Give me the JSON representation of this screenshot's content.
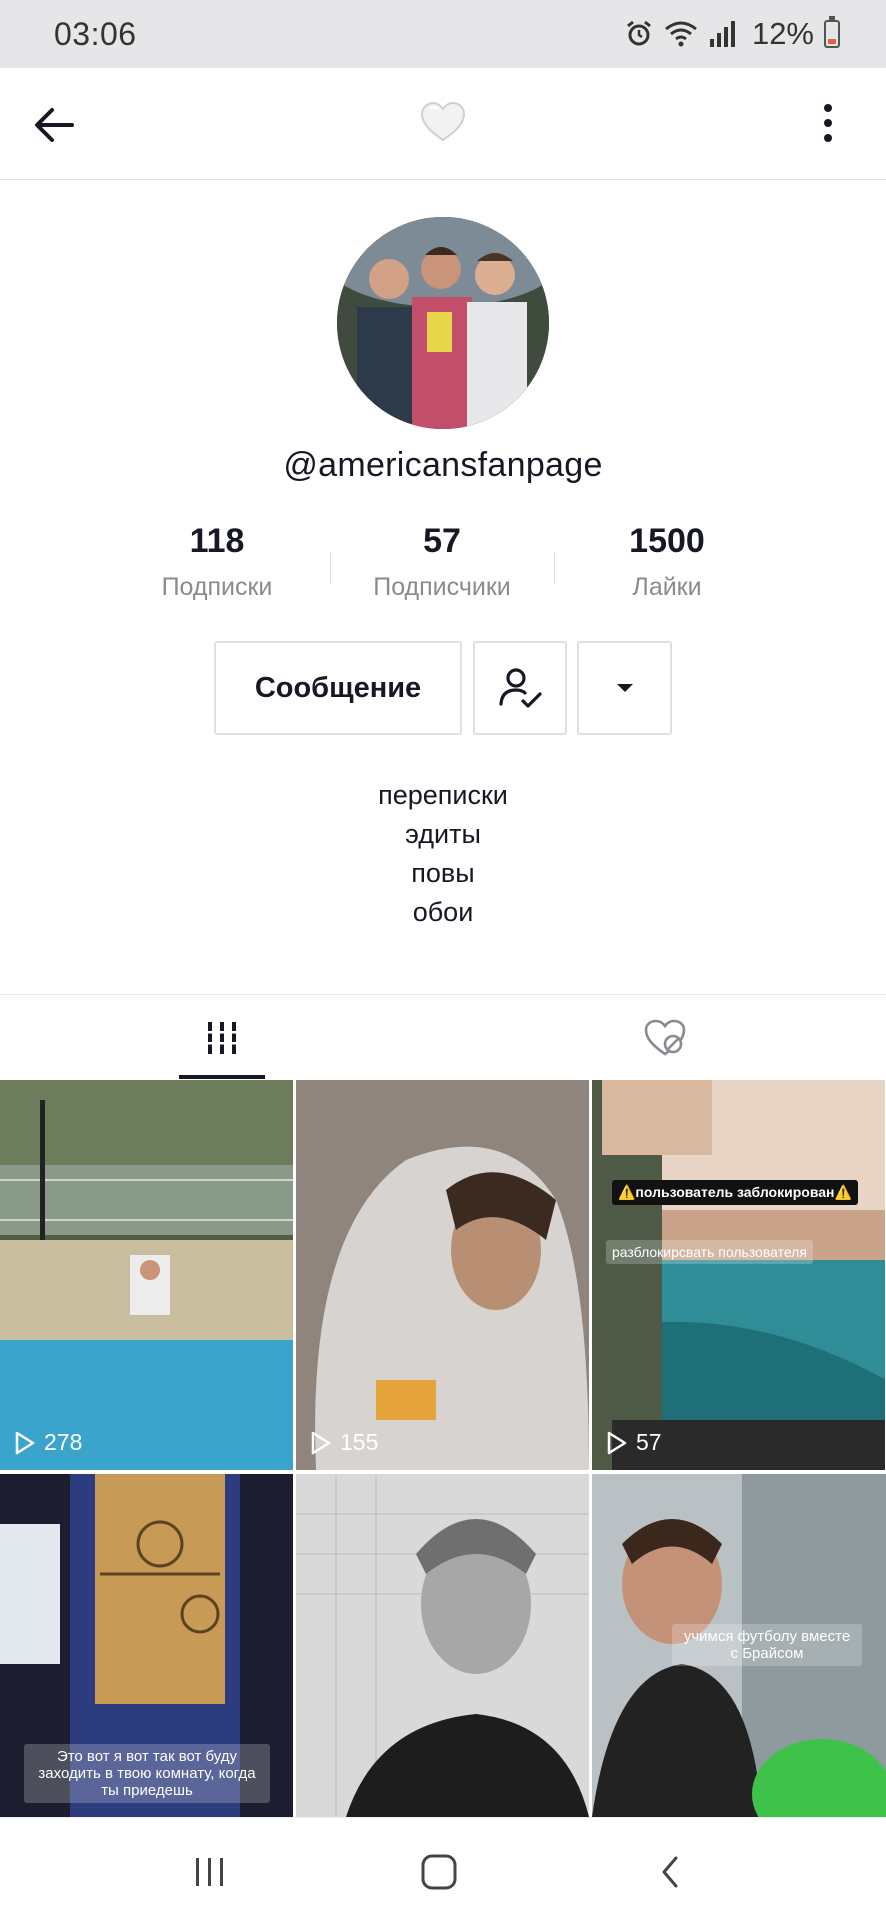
{
  "status_bar": {
    "time": "03:06",
    "battery": "12%"
  },
  "profile": {
    "username": "@americansfanpage",
    "stats": [
      {
        "value": "118",
        "label": "Подписки"
      },
      {
        "value": "57",
        "label": "Подписчики"
      },
      {
        "value": "1500",
        "label": "Лайки"
      }
    ],
    "message_button": "Сообщение",
    "bio": [
      "переписки",
      "эдиты",
      "повы",
      "обои"
    ]
  },
  "videos": [
    {
      "views": "278",
      "overlay": "",
      "colors": [
        "#5a6b48",
        "#bfb49a",
        "#3aa0c8"
      ]
    },
    {
      "views": "155",
      "overlay": "",
      "colors": [
        "#d9d6d4",
        "#a8a4a2",
        "#6a5f58"
      ]
    },
    {
      "views": "57",
      "overlay": "⚠️пользователь заблокирован⚠️",
      "overlay2": "разблокирсвать пользователя",
      "colors": [
        "#e9d2c2",
        "#5f6a5c",
        "#2c7f8c"
      ]
    },
    {
      "views": "",
      "overlay": "Это вот я вот так вот буду заходить в твою комнату, когда ты приедешь",
      "colors": [
        "#2a3556",
        "#c49b5a",
        "#1c1e2f"
      ]
    },
    {
      "views": "",
      "overlay": "",
      "colors": [
        "#e6e6e6",
        "#9c9c9c",
        "#1d1d1d"
      ]
    },
    {
      "views": "",
      "overlay": "учимся футболу вместе с Брайсом",
      "colors": [
        "#c8cfd4",
        "#5b5e58",
        "#2b2b2b"
      ]
    }
  ],
  "colors": {
    "text": "#161823",
    "secondary_text": "#8a8b91",
    "border": "#e0e0e2",
    "status_bar": "#e6e6e8"
  }
}
